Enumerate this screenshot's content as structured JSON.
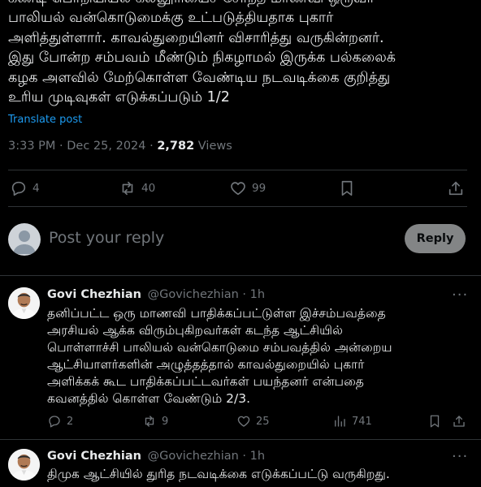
{
  "main_tweet": {
    "text": "கண்டி பொறியியல் கல்லூரியைச் சேர்ந்த மாணவி ஒருவர்\nபாலியல் வன்கொடுமைக்கு உட்படுத்தியதாக புகார்\nஅளித்துள்ளார். காவல்துறையினர் விசாரித்து வருகின்றனர்.\nஇது போன்ற சம்பவம் மீண்டும் நிகழாமல் இருக்க பல்கலைக்\nகழக அளவில் மேற்கொள்ள வேண்டிய நடவடிக்கை குறித்து\nஉரிய முடிவுகள் எடுக்கப்படும் 1/2",
    "translate_label": "Translate post",
    "timestamp": "3:33 PM · Dec 25, 2024 · ",
    "views_count": "2,782",
    "views_label": " Views",
    "replies": "4",
    "reposts": "40",
    "likes": "99"
  },
  "reply_box": {
    "placeholder": "Post your reply",
    "button_label": "Reply"
  },
  "replies": [
    {
      "name": "Govi Chezhian",
      "handle": "@Govichezhian · 1h",
      "text": "தனிப்பட்ட ஒரு மாணவி பாதிக்கப்பட்டுள்ள இச்சம்பவத்தை\nஅரசியல் ஆக்க விரும்புகிறவர்கள் கடந்த ஆட்சியில்\nபொள்ளாச்சி பாலியல் வன்கொடுமை சம்பவத்தில் அன்றைய\nஆட்சியாளர்களின் அழுத்தத்தால் காவல்துறையில் புகார்\nஅளிக்கக் கூட பாதிக்கப்பட்டவர்கள் பயந்தனர் என்பதை\nகவனத்தில் கொள்ள வேண்டும் 2/3.",
      "replies": "2",
      "reposts": "9",
      "likes": "25",
      "views": "741"
    },
    {
      "name": "Govi Chezhian",
      "handle": "@Govichezhian · 1h",
      "text": "திமுக ஆட்சியில் துரித நடவடிக்கை எடுக்கப்பட்டு வருகிறது."
    }
  ],
  "colors": {
    "background": "#000000",
    "text": "#e7e9ea",
    "muted": "#71767b",
    "link": "#1d9bf0",
    "divider": "#2f3336"
  }
}
